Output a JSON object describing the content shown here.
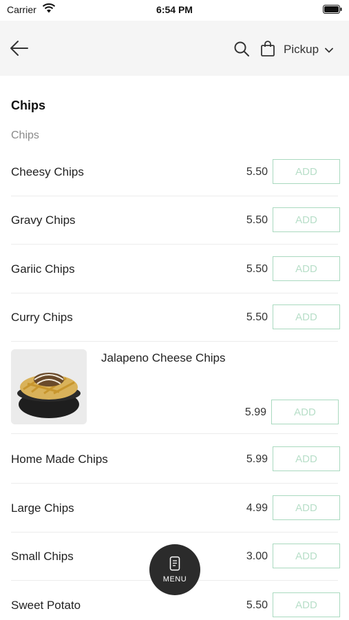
{
  "status": {
    "carrier": "Carrier",
    "time": "6:54 PM"
  },
  "nav": {
    "pickup_label": "Pickup"
  },
  "section": {
    "title": "Chips",
    "subtitle": "Chips"
  },
  "items": [
    {
      "name": "Cheesy Chips",
      "price": "5.50",
      "add": "ADD"
    },
    {
      "name": "Gravy Chips",
      "price": "5.50",
      "add": "ADD"
    },
    {
      "name": "Gariic Chips",
      "price": "5.50",
      "add": "ADD"
    },
    {
      "name": "Curry Chips",
      "price": "5.50",
      "add": "ADD"
    },
    {
      "name": "Jalapeno Cheese Chips",
      "price": "5.99",
      "add": "ADD"
    },
    {
      "name": "Home Made Chips",
      "price": "5.99",
      "add": "ADD"
    },
    {
      "name": "Large Chips",
      "price": "4.99",
      "add": "ADD"
    },
    {
      "name": "Small Chips",
      "price": "3.00",
      "add": "ADD"
    },
    {
      "name": "Sweet Potato",
      "price": "5.50",
      "add": "ADD"
    }
  ],
  "menu_button": {
    "label": "MENU"
  },
  "colors": {
    "nav_bg": "#f5f5f5",
    "add_border": "#a9d9bf",
    "add_text": "#b7dec8",
    "fab_bg": "#2b2b2b"
  },
  "icons": [
    "wifi-icon",
    "battery-icon",
    "back-arrow-icon",
    "search-icon",
    "shopping-bag-icon",
    "chevron-down-icon",
    "menu-phone-icon"
  ]
}
